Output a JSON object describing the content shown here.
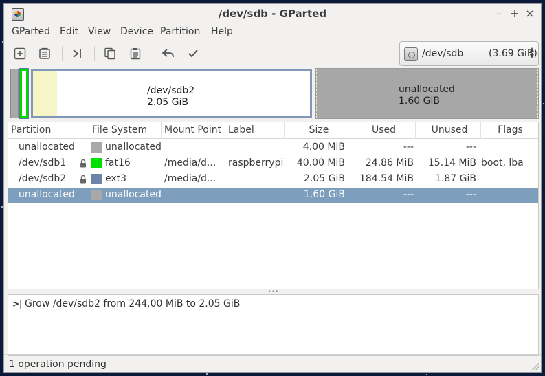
{
  "window": {
    "title": "/dev/sdb - GParted"
  },
  "menu": [
    "GParted",
    "Edit",
    "View",
    "Device",
    "Partition",
    "Help"
  ],
  "toolbar": {
    "icons": [
      "new-partition-icon",
      "delete-icon",
      "resize-move-icon",
      "copy-icon",
      "paste-icon",
      "undo-icon",
      "apply-icon"
    ]
  },
  "device_selector": {
    "device": "/dev/sdb",
    "size": "(3.69 GiB)"
  },
  "disk_map": {
    "partition_label": "/dev/sdb2",
    "partition_size": "2.05 GiB",
    "unallocated_label": "unallocated",
    "unallocated_size": "1.60 GiB"
  },
  "table": {
    "columns": [
      "Partition",
      "File System",
      "Mount Point",
      "Label",
      "Size",
      "Used",
      "Unused",
      "Flags"
    ],
    "rows": [
      {
        "partition": "unallocated",
        "locked": false,
        "fs": "unallocated",
        "fs_color": "#a9a9a9",
        "mount": "",
        "label": "",
        "size": "4.00 MiB",
        "used": "---",
        "unused": "---",
        "flags": ""
      },
      {
        "partition": "/dev/sdb1",
        "locked": true,
        "fs": "fat16",
        "fs_color": "#00e000",
        "mount": "/media/d...",
        "label": "raspberrypi",
        "size": "40.00 MiB",
        "used": "24.86 MiB",
        "unused": "15.14 MiB",
        "flags": "boot, lba"
      },
      {
        "partition": "/dev/sdb2",
        "locked": true,
        "fs": "ext3",
        "fs_color": "#6b84a8",
        "mount": "/media/d...",
        "label": "",
        "size": "2.05 GiB",
        "used": "184.54 MiB",
        "unused": "1.87 GiB",
        "flags": ""
      },
      {
        "partition": "unallocated",
        "locked": false,
        "fs": "unallocated",
        "fs_color": "#a9a9a9",
        "mount": "",
        "label": "",
        "size": "1.60 GiB",
        "used": "---",
        "unused": "---",
        "flags": "",
        "selected": true
      }
    ]
  },
  "operations": [
    {
      "text": "Grow /dev/sdb2 from 244.00 MiB to 2.05 GiB"
    }
  ],
  "status": {
    "text": "1 operation pending"
  }
}
